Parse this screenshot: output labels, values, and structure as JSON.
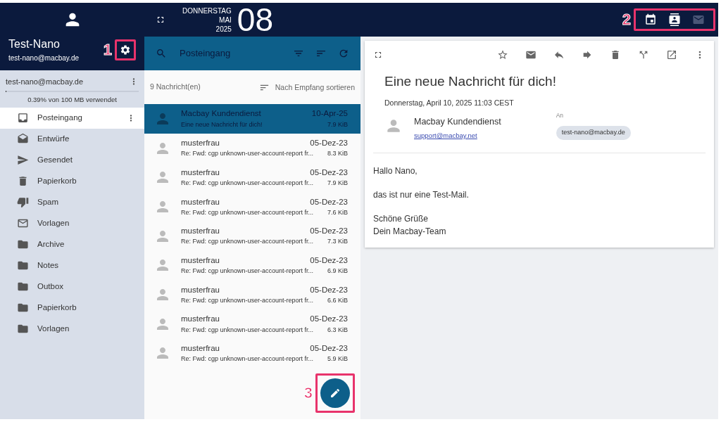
{
  "profile": {
    "name": "Test-Nano",
    "email": "test-nano@macbay.de",
    "settings_callout": "1"
  },
  "date": {
    "weekday": "DONNERSTAG",
    "month": "MAI",
    "year": "2025",
    "day": "08"
  },
  "apps": {
    "callout": "2",
    "items": [
      {
        "kind": "calendar",
        "selected": false
      },
      {
        "kind": "contacts",
        "selected": false
      },
      {
        "kind": "mail",
        "selected": true
      }
    ]
  },
  "account": {
    "email": "test-nano@macbay.de",
    "usage": "0.39% von 100 MB verwendet",
    "level": 0.0039
  },
  "folders": [
    {
      "kind": "inbox",
      "label": "Posteingang",
      "selected": true
    },
    {
      "kind": "drafts",
      "label": "Entwürfe",
      "selected": false
    },
    {
      "kind": "sent",
      "label": "Gesendet",
      "selected": false
    },
    {
      "kind": "trash",
      "label": "Papierkorb",
      "selected": false
    },
    {
      "kind": "spam",
      "label": "Spam",
      "selected": false
    },
    {
      "kind": "templates",
      "label": "Vorlagen",
      "selected": false
    },
    {
      "kind": "folder",
      "label": "Archive",
      "selected": false
    },
    {
      "kind": "folder",
      "label": "Notes",
      "selected": false
    },
    {
      "kind": "folder",
      "label": "Outbox",
      "selected": false
    },
    {
      "kind": "folder",
      "label": "Papierkorb",
      "selected": false
    },
    {
      "kind": "folder",
      "label": "Vorlagen",
      "selected": false
    }
  ],
  "search": {
    "placeholder": "Posteingang"
  },
  "list_header": {
    "count": "9 Nachricht(en)",
    "sort": "Nach Empfang sortieren"
  },
  "messages": [
    {
      "sender": "Macbay Kundendienst",
      "date": "10-Apr-25",
      "subject": "Eine neue Nachricht für dich!",
      "size": "7.9 KiB",
      "selected": true
    },
    {
      "sender": "musterfrau",
      "date": "05-Dez-23",
      "subject": "Re: Fwd: cgp unknown-user-account-report fr...",
      "size": "8.3 KiB",
      "selected": false
    },
    {
      "sender": "musterfrau",
      "date": "05-Dez-23",
      "subject": "Re: Fwd: cgp unknown-user-account-report fr...",
      "size": "7.9 KiB",
      "selected": false
    },
    {
      "sender": "musterfrau",
      "date": "05-Dez-23",
      "subject": "Re: Fwd: cgp unknown-user-account-report fr...",
      "size": "7.6 KiB",
      "selected": false
    },
    {
      "sender": "musterfrau",
      "date": "05-Dez-23",
      "subject": "Re: Fwd: cgp unknown-user-account-report fr...",
      "size": "7.3 KiB",
      "selected": false
    },
    {
      "sender": "musterfrau",
      "date": "05-Dez-23",
      "subject": "Re: Fwd: cgp unknown-user-account-report fr...",
      "size": "6.9 KiB",
      "selected": false
    },
    {
      "sender": "musterfrau",
      "date": "05-Dez-23",
      "subject": "Re: Fwd: cgp unknown-user-account-report fr...",
      "size": "6.6 KiB",
      "selected": false
    },
    {
      "sender": "musterfrau",
      "date": "05-Dez-23",
      "subject": "Re: Fwd: cgp unknown-user-account-report fr...",
      "size": "6.3 KiB",
      "selected": false
    },
    {
      "sender": "musterfrau",
      "date": "05-Dez-23",
      "subject": "Re: Fwd: cgp unknown-user-account-report fr...",
      "size": "5.9 KiB",
      "selected": false
    }
  ],
  "compose": {
    "callout": "3"
  },
  "email": {
    "subject": "Eine neue Nachricht für dich!",
    "date": "Donnerstag, April 10, 2025 11:03 CEST",
    "from_name": "Macbay Kundendienst",
    "from_email": "support@macbay.net",
    "to_label": "An",
    "to": "test-nano@macbay.de",
    "paragraphs": [
      [
        "Hallo Nano,"
      ],
      [
        "das ist nur eine Test-Mail."
      ],
      [
        "Schöne Grüße",
        "Dein Macbay-Team"
      ]
    ]
  }
}
